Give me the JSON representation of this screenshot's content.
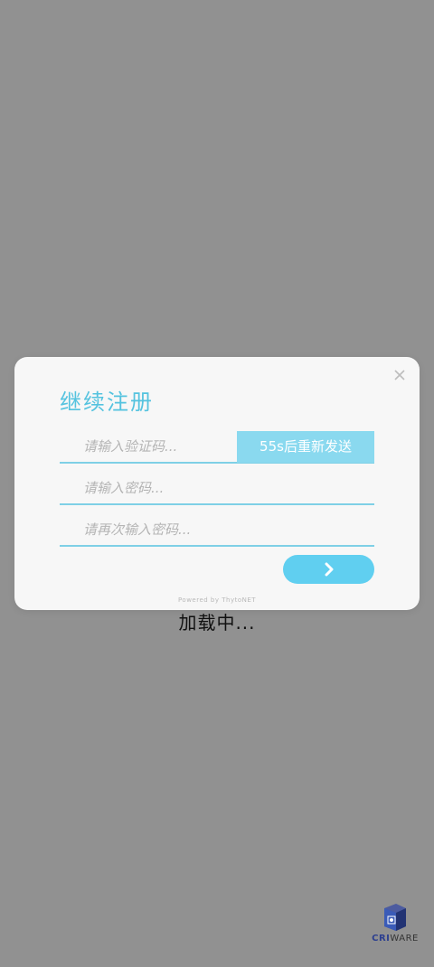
{
  "loading": {
    "text": "加载中..."
  },
  "dialog": {
    "title": "继续注册",
    "code_placeholder": "请输入验证码...",
    "resend_label": "55s后重新发送",
    "password_placeholder": "请输入密码...",
    "password_confirm_placeholder": "请再次输入密码...",
    "next_icon": "chevron-right-icon",
    "close_icon": "close-icon",
    "powered_by": "Powered by ThytoNET"
  },
  "logo": {
    "part1": "CRI",
    "part2": "WARE"
  },
  "colors": {
    "background": "#919191",
    "dialog_bg": "#f7f7f7",
    "accent": "#55c3df",
    "resend_bg": "#8ad9ef",
    "next_bg": "#60cff0"
  }
}
